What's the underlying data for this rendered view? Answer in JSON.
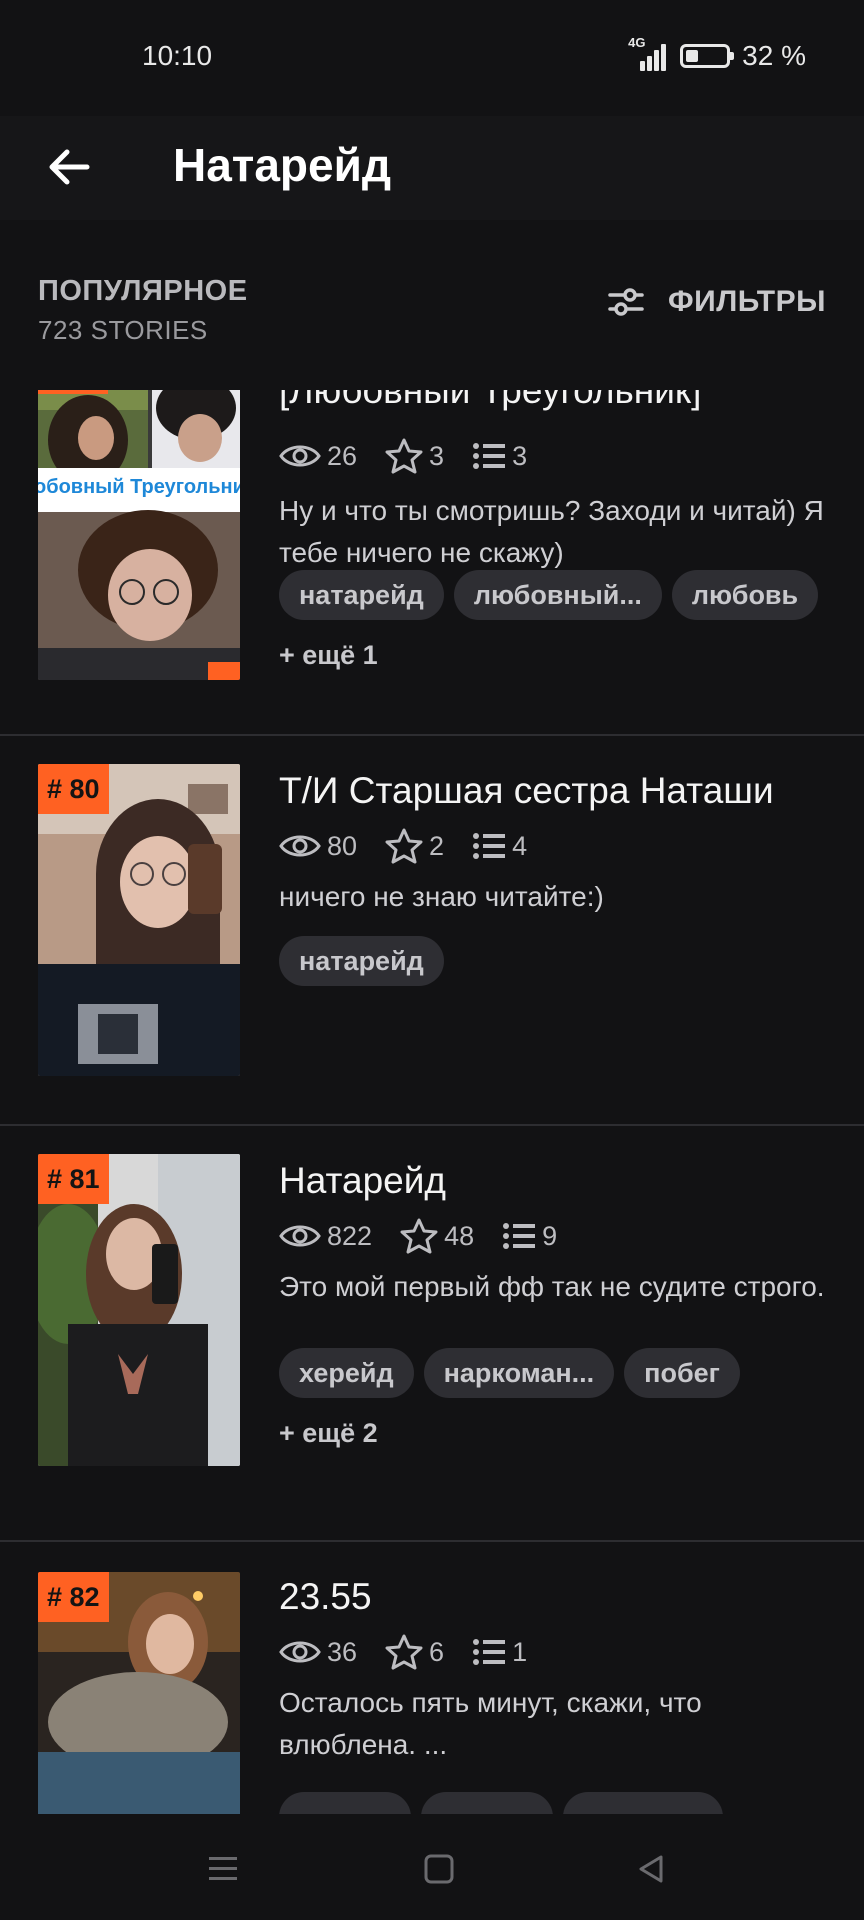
{
  "status": {
    "time": "10:10",
    "network": "4G",
    "battery_text": "32 %",
    "battery_level": 0.32
  },
  "header": {
    "title": "Натарейд"
  },
  "section": {
    "label": "ПОПУЛЯРНОЕ",
    "count": "723 STORIES",
    "filters_label": "ФИЛЬТРЫ"
  },
  "stories": [
    {
      "title": "[Любовный Треугольник]",
      "views": "26",
      "votes": "3",
      "parts": "3",
      "description": "Ну и что ты смотришь? Заходи и читай) Я тебе ничего не скажу)",
      "tags": [
        "натарейд",
        "любовный...",
        "любовь"
      ],
      "more": "+ ещё 1",
      "cover_text": "обовный Треугольни"
    },
    {
      "rank": "# 80",
      "title": "Т/И Старшая сестра Наташи",
      "views": "80",
      "votes": "2",
      "parts": "4",
      "description": "ничего не знаю читайте:)",
      "tags": [
        "натарейд"
      ]
    },
    {
      "rank": "# 81",
      "title": "Натарейд",
      "views": "822",
      "votes": "48",
      "parts": "9",
      "description": "Это мой первый фф так не судите строго.",
      "tags": [
        "херейд",
        "наркоман...",
        "побег"
      ],
      "more": "+ ещё 2"
    },
    {
      "rank": "# 82",
      "title": "23.55",
      "views": "36",
      "votes": "6",
      "parts": "1",
      "description": "Осталось пять минут, скажи, что влюблена. ..."
    }
  ],
  "colors": {
    "accent": "#ff6122",
    "background": "#121214",
    "tag_bg": "#2e2e33"
  }
}
